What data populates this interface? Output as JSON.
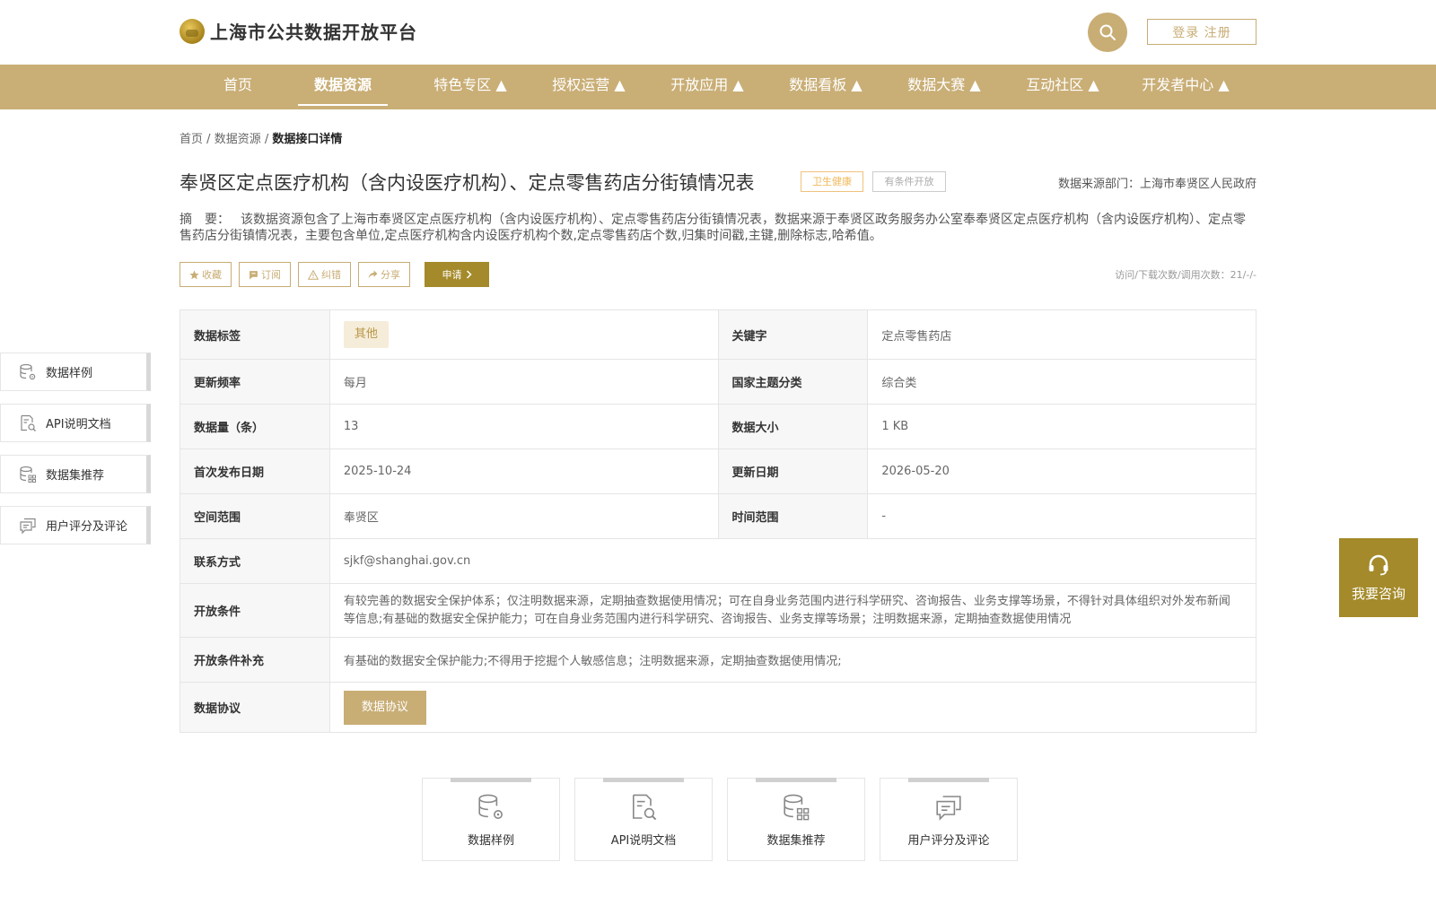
{
  "header": {
    "site_title": "上海市公共数据开放平台",
    "login_label": "登录 注册"
  },
  "nav": {
    "items": [
      {
        "label": "首页"
      },
      {
        "label": "数据资源"
      },
      {
        "label": "特色专区 ▲"
      },
      {
        "label": "授权运营 ▲"
      },
      {
        "label": "开放应用 ▲"
      },
      {
        "label": "数据看板 ▲"
      },
      {
        "label": "数据大赛 ▲"
      },
      {
        "label": "互动社区 ▲"
      },
      {
        "label": "开发者中心 ▲"
      }
    ],
    "active_index": 1
  },
  "breadcrumb": {
    "home": "首页",
    "resources": "数据资源",
    "sep": "/",
    "current": "数据接口详情"
  },
  "dataset": {
    "title": "奉贤区定点医疗机构（含内设医疗机构）、定点零售药店分街镇情况表",
    "tag_category": "卫生健康",
    "tag_open": "有条件开放",
    "source_dept": "数据来源部门：上海市奉贤区人民政府",
    "summary_label": "摘　要：",
    "summary_line1_tail": "该数据资源包含了上海市奉贤区定点医疗机构（含内设医疗机构）、定点零售药店分街镇情况表，数据来源于奉贤区政务服务办公室奉奉贤区定点医疗机构（含内设医",
    "summary": "疗机构）、定点零售药店分街镇情况表，主要包含单位,定点医疗机构含内设医疗机构个数,定点零售药店个数,归集时间戳,主键,删除标志,哈希值。",
    "visits": "访问/下载次数/调用次数：21/-/-"
  },
  "actions": {
    "favorite": "收藏",
    "subscribe": "订阅",
    "report": "纠错",
    "share": "分享",
    "apply": "申请"
  },
  "info": {
    "labels": {
      "tag": "数据标签",
      "keyword": "关键字",
      "frequency": "更新频率",
      "national_theme": "国家主题分类",
      "count": "数据量（条）",
      "size": "数据大小",
      "first_publish": "首次发布日期",
      "update_date": "更新日期",
      "spatial": "空间范围",
      "time_range": "时间范围",
      "contact": "联系方式",
      "open_conditions": "开放条件",
      "open_supplement": "开放条件补充",
      "agreement": "数据协议"
    },
    "values": {
      "tag": "其他",
      "keyword": "定点零售药店",
      "frequency": "每月",
      "national_theme": "综合类",
      "count": "13",
      "size": "1 KB",
      "first_publish": "2025-10-24",
      "update_date": "2026-05-20",
      "spatial": "奉贤区",
      "time_range": "-",
      "contact": "sjkf@shanghai.gov.cn",
      "open_conditions": "有较完善的数据安全保护体系；仅注明数据来源，定期抽查数据使用情况；可在自身业务范围内进行科学研究、咨询报告、业务支撑等场景，不得针对具体组织对外发布新闻等信息;有基础的数据安全保护能力；可在自身业务范围内进行科学研究、咨询报告、业务支撑等场景；注明数据来源，定期抽查数据使用情况",
      "open_supplement": "有基础的数据安全保护能力;不得用于挖掘个人敏感信息；注明数据来源，定期抽查数据使用情况;",
      "agreement_button": "数据协议"
    }
  },
  "side_menu": {
    "items": [
      {
        "label": "数据样例",
        "icon": "database-gear-icon"
      },
      {
        "label": "API说明文档",
        "icon": "document-search-icon"
      },
      {
        "label": "数据集推荐",
        "icon": "database-grid-icon"
      },
      {
        "label": "用户评分及评论",
        "icon": "comment-icon"
      }
    ]
  },
  "consult": {
    "label": "我要咨询",
    "icon": "headset-icon"
  },
  "cards": {
    "items": [
      {
        "label": "数据样例",
        "icon": "database-gear-icon"
      },
      {
        "label": "API说明文档",
        "icon": "document-search-icon"
      },
      {
        "label": "数据集推荐",
        "icon": "database-grid-icon"
      },
      {
        "label": "用户评分及评论",
        "icon": "comment-icon"
      }
    ]
  },
  "colors": {
    "brand": "#c9ae76",
    "accent_dark": "#a48a2a",
    "tag_orange": "#f1b85a"
  }
}
